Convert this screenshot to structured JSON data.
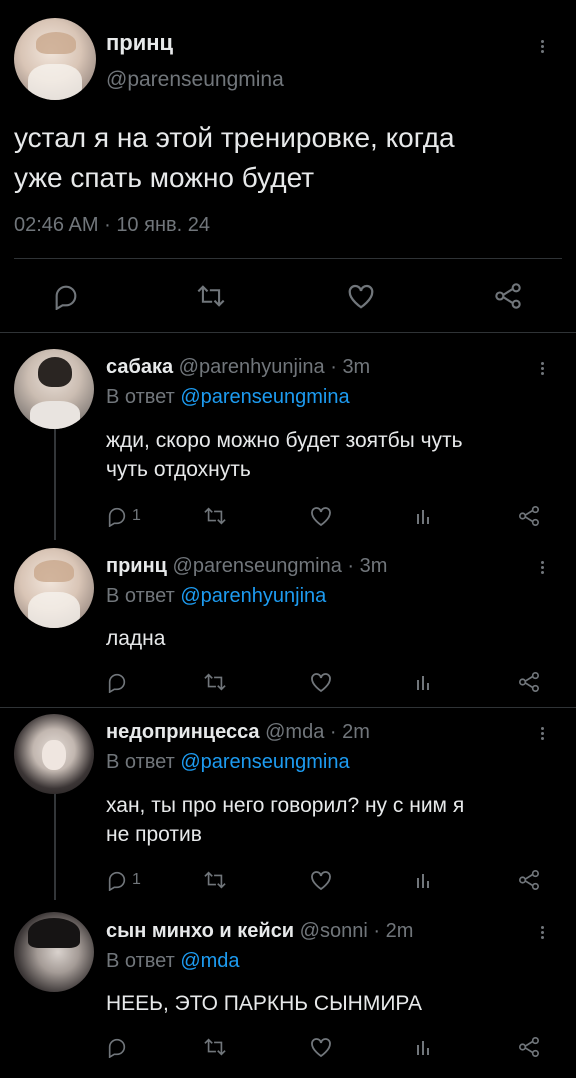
{
  "colors": {
    "background": "#000000",
    "text": "#e7e9ea",
    "secondary": "#71767b",
    "accent": "#1d9bf0",
    "divider": "#2f3336"
  },
  "main_tweet": {
    "display_name": "принц",
    "handle": "@parenseungmina",
    "text_line1": "устал я на этой тренировке, когда",
    "text_line2": "уже спать можно будет",
    "time": "02:46 AM",
    "sep": "·",
    "date": "10 янв. 24",
    "icons": [
      "reply-icon",
      "retweet-icon",
      "like-icon",
      "share-icon"
    ]
  },
  "replies": [
    {
      "display_name": "сабака",
      "handle": "@parenhyunjina",
      "dot": "·",
      "age": "3m",
      "reply_prefix": "В ответ",
      "reply_to": "@parenseungmina",
      "text_line1": "жди, скоро можно будет зоятбы чуть",
      "text_line2": "чуть отдохнуть",
      "reply_count": "1"
    },
    {
      "display_name": "принц",
      "handle": "@parenseungmina",
      "dot": "·",
      "age": "3m",
      "reply_prefix": "В ответ",
      "reply_to": "@parenhyunjina",
      "text_line1": "ладна",
      "text_line2": "",
      "reply_count": ""
    },
    {
      "display_name": "недопринцесса",
      "handle": "@mda",
      "dot": "·",
      "age": "2m",
      "reply_prefix": "В ответ",
      "reply_to": "@parenseungmina",
      "text_line1": "хан, ты про него говорил? ну с ним я",
      "text_line2": "не против",
      "reply_count": "1"
    },
    {
      "display_name": "сын минхо и кейси",
      "handle": "@sonni",
      "dot": "·",
      "age": "2m",
      "reply_prefix": "В ответ",
      "reply_to": "@mda",
      "text_line1": "НЕЕЬ, ЭТО ПАРКНЬ СЫНМИРА",
      "text_line2": "",
      "reply_count": ""
    }
  ]
}
